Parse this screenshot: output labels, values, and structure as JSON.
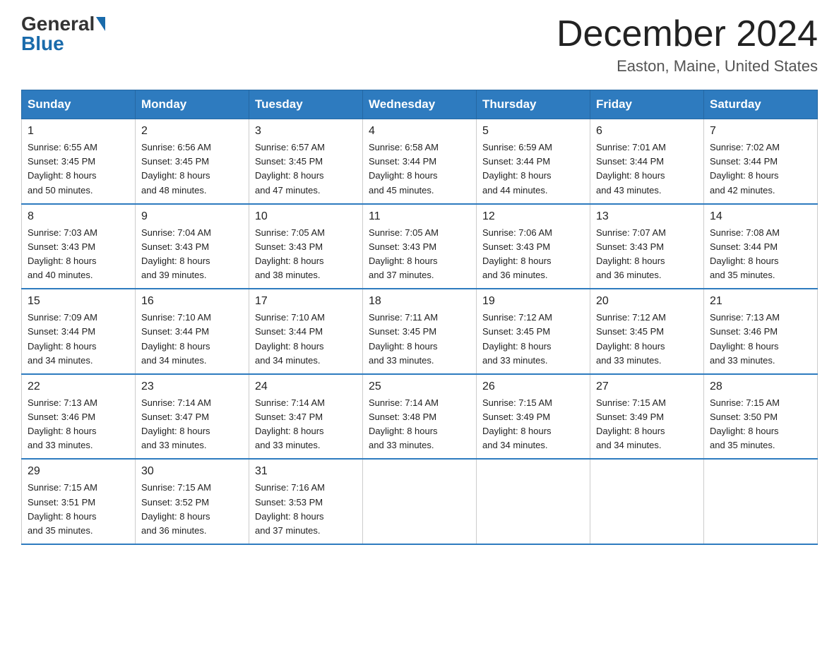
{
  "logo": {
    "general": "General",
    "blue": "Blue"
  },
  "title": "December 2024",
  "location": "Easton, Maine, United States",
  "days_of_week": [
    "Sunday",
    "Monday",
    "Tuesday",
    "Wednesday",
    "Thursday",
    "Friday",
    "Saturday"
  ],
  "weeks": [
    [
      {
        "day": "1",
        "sunrise": "6:55 AM",
        "sunset": "3:45 PM",
        "daylight": "8 hours and 50 minutes."
      },
      {
        "day": "2",
        "sunrise": "6:56 AM",
        "sunset": "3:45 PM",
        "daylight": "8 hours and 48 minutes."
      },
      {
        "day": "3",
        "sunrise": "6:57 AM",
        "sunset": "3:45 PM",
        "daylight": "8 hours and 47 minutes."
      },
      {
        "day": "4",
        "sunrise": "6:58 AM",
        "sunset": "3:44 PM",
        "daylight": "8 hours and 45 minutes."
      },
      {
        "day": "5",
        "sunrise": "6:59 AM",
        "sunset": "3:44 PM",
        "daylight": "8 hours and 44 minutes."
      },
      {
        "day": "6",
        "sunrise": "7:01 AM",
        "sunset": "3:44 PM",
        "daylight": "8 hours and 43 minutes."
      },
      {
        "day": "7",
        "sunrise": "7:02 AM",
        "sunset": "3:44 PM",
        "daylight": "8 hours and 42 minutes."
      }
    ],
    [
      {
        "day": "8",
        "sunrise": "7:03 AM",
        "sunset": "3:43 PM",
        "daylight": "8 hours and 40 minutes."
      },
      {
        "day": "9",
        "sunrise": "7:04 AM",
        "sunset": "3:43 PM",
        "daylight": "8 hours and 39 minutes."
      },
      {
        "day": "10",
        "sunrise": "7:05 AM",
        "sunset": "3:43 PM",
        "daylight": "8 hours and 38 minutes."
      },
      {
        "day": "11",
        "sunrise": "7:05 AM",
        "sunset": "3:43 PM",
        "daylight": "8 hours and 37 minutes."
      },
      {
        "day": "12",
        "sunrise": "7:06 AM",
        "sunset": "3:43 PM",
        "daylight": "8 hours and 36 minutes."
      },
      {
        "day": "13",
        "sunrise": "7:07 AM",
        "sunset": "3:43 PM",
        "daylight": "8 hours and 36 minutes."
      },
      {
        "day": "14",
        "sunrise": "7:08 AM",
        "sunset": "3:44 PM",
        "daylight": "8 hours and 35 minutes."
      }
    ],
    [
      {
        "day": "15",
        "sunrise": "7:09 AM",
        "sunset": "3:44 PM",
        "daylight": "8 hours and 34 minutes."
      },
      {
        "day": "16",
        "sunrise": "7:10 AM",
        "sunset": "3:44 PM",
        "daylight": "8 hours and 34 minutes."
      },
      {
        "day": "17",
        "sunrise": "7:10 AM",
        "sunset": "3:44 PM",
        "daylight": "8 hours and 34 minutes."
      },
      {
        "day": "18",
        "sunrise": "7:11 AM",
        "sunset": "3:45 PM",
        "daylight": "8 hours and 33 minutes."
      },
      {
        "day": "19",
        "sunrise": "7:12 AM",
        "sunset": "3:45 PM",
        "daylight": "8 hours and 33 minutes."
      },
      {
        "day": "20",
        "sunrise": "7:12 AM",
        "sunset": "3:45 PM",
        "daylight": "8 hours and 33 minutes."
      },
      {
        "day": "21",
        "sunrise": "7:13 AM",
        "sunset": "3:46 PM",
        "daylight": "8 hours and 33 minutes."
      }
    ],
    [
      {
        "day": "22",
        "sunrise": "7:13 AM",
        "sunset": "3:46 PM",
        "daylight": "8 hours and 33 minutes."
      },
      {
        "day": "23",
        "sunrise": "7:14 AM",
        "sunset": "3:47 PM",
        "daylight": "8 hours and 33 minutes."
      },
      {
        "day": "24",
        "sunrise": "7:14 AM",
        "sunset": "3:47 PM",
        "daylight": "8 hours and 33 minutes."
      },
      {
        "day": "25",
        "sunrise": "7:14 AM",
        "sunset": "3:48 PM",
        "daylight": "8 hours and 33 minutes."
      },
      {
        "day": "26",
        "sunrise": "7:15 AM",
        "sunset": "3:49 PM",
        "daylight": "8 hours and 34 minutes."
      },
      {
        "day": "27",
        "sunrise": "7:15 AM",
        "sunset": "3:49 PM",
        "daylight": "8 hours and 34 minutes."
      },
      {
        "day": "28",
        "sunrise": "7:15 AM",
        "sunset": "3:50 PM",
        "daylight": "8 hours and 35 minutes."
      }
    ],
    [
      {
        "day": "29",
        "sunrise": "7:15 AM",
        "sunset": "3:51 PM",
        "daylight": "8 hours and 35 minutes."
      },
      {
        "day": "30",
        "sunrise": "7:15 AM",
        "sunset": "3:52 PM",
        "daylight": "8 hours and 36 minutes."
      },
      {
        "day": "31",
        "sunrise": "7:16 AM",
        "sunset": "3:53 PM",
        "daylight": "8 hours and 37 minutes."
      },
      null,
      null,
      null,
      null
    ]
  ],
  "labels": {
    "sunrise": "Sunrise:",
    "sunset": "Sunset:",
    "daylight": "Daylight:"
  }
}
